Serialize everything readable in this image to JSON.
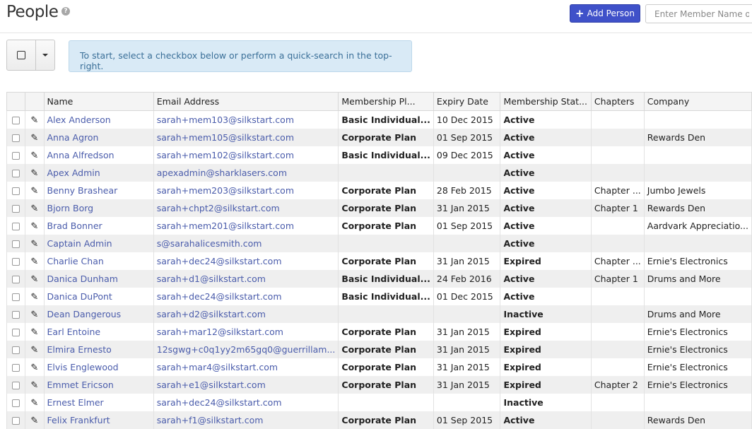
{
  "header": {
    "title": "People",
    "help_icon": "question-circle-icon",
    "add_button": "Add Person",
    "search_placeholder": "Enter Member Name or Email"
  },
  "info_text": "To start, select a checkbox below or perform a quick-search in the top-right.",
  "columns": [
    "Name",
    "Email Address",
    "Membership Pl...",
    "Expiry Date",
    "Membership Stat...",
    "Chapters",
    "Company"
  ],
  "colors": {
    "active": "#4a8a1a",
    "expired": "#c81f1f",
    "inactive": "#a0a0a0",
    "link": "#4a5cab",
    "button": "#3f51c9"
  },
  "rows": [
    {
      "name": "Alex Anderson",
      "email": "sarah+mem103@silkstart.com",
      "plan": "Basic Individual...",
      "plan_color": "green",
      "expiry": "10 Dec 2015",
      "status": "Active",
      "chapters": "",
      "company": ""
    },
    {
      "name": "Anna Agron",
      "email": "sarah+mem105@silkstart.com",
      "plan": "Corporate Plan",
      "plan_color": "green",
      "expiry": "01 Sep 2015",
      "status": "Active",
      "chapters": "",
      "company": "Rewards Den"
    },
    {
      "name": "Anna Alfredson",
      "email": "sarah+mem102@silkstart.com",
      "plan": "Basic Individual...",
      "plan_color": "green",
      "expiry": "09 Dec 2015",
      "status": "Active",
      "chapters": "",
      "company": ""
    },
    {
      "name": "Apex Admin",
      "email": "apexadmin@sharklasers.com",
      "plan": "",
      "plan_color": "green",
      "expiry": "",
      "status": "Active",
      "chapters": "",
      "company": ""
    },
    {
      "name": "Benny Brashear",
      "email": "sarah+mem203@silkstart.com",
      "plan": "Corporate Plan",
      "plan_color": "green",
      "expiry": "28 Feb 2015",
      "status": "Active",
      "chapters": "Chapter ...",
      "company": "Jumbo Jewels"
    },
    {
      "name": "Bjorn Borg",
      "email": "sarah+chpt2@silkstart.com",
      "plan": "Corporate Plan",
      "plan_color": "green",
      "expiry": "31 Jan 2015",
      "status": "Active",
      "chapters": "Chapter 1",
      "company": "Rewards Den"
    },
    {
      "name": "Brad Bonner",
      "email": "sarah+mem201@silkstart.com",
      "plan": "Corporate Plan",
      "plan_color": "green",
      "expiry": "01 Sep 2015",
      "status": "Active",
      "chapters": "",
      "company": "Aardvark Appreciatio..."
    },
    {
      "name": "Captain Admin",
      "email": "s@sarahalicesmith.com",
      "plan": "",
      "plan_color": "green",
      "expiry": "",
      "status": "Active",
      "chapters": "",
      "company": ""
    },
    {
      "name": "Charlie Chan",
      "email": "sarah+dec24@silkstart.com",
      "plan": "Corporate Plan",
      "plan_color": "red",
      "expiry": "31 Jan 2015",
      "status": "Expired",
      "chapters": "Chapter ...",
      "company": "Ernie's Electronics"
    },
    {
      "name": "Danica Dunham",
      "email": "sarah+d1@silkstart.com",
      "plan": "Basic Individual...",
      "plan_color": "green",
      "expiry": "24 Feb 2016",
      "status": "Active",
      "chapters": "Chapter 1",
      "company": "Drums and More"
    },
    {
      "name": "Danica DuPont",
      "email": "sarah+dec24@silkstart.com",
      "plan": "Basic Individual...",
      "plan_color": "green",
      "expiry": "01 Dec 2015",
      "status": "Active",
      "chapters": "",
      "company": ""
    },
    {
      "name": "Dean Dangerous",
      "email": "sarah+d2@silkstart.com",
      "plan": "",
      "plan_color": "green",
      "expiry": "",
      "status": "Inactive",
      "chapters": "",
      "company": "Drums and More"
    },
    {
      "name": "Earl Entoine",
      "email": "sarah+mar12@silkstart.com",
      "plan": "Corporate Plan",
      "plan_color": "red",
      "expiry": "31 Jan 2015",
      "status": "Expired",
      "chapters": "",
      "company": "Ernie's Electronics"
    },
    {
      "name": "Elmira Ernesto",
      "email": "12sgwg+c0q1yy2m65gq0@guerrillam...",
      "plan": "Corporate Plan",
      "plan_color": "red",
      "expiry": "31 Jan 2015",
      "status": "Expired",
      "chapters": "",
      "company": "Ernie's Electronics"
    },
    {
      "name": "Elvis Englewood",
      "email": "sarah+mar4@silkstart.com",
      "plan": "Corporate Plan",
      "plan_color": "red",
      "expiry": "31 Jan 2015",
      "status": "Expired",
      "chapters": "",
      "company": "Ernie's Electronics"
    },
    {
      "name": "Emmet Ericson",
      "email": "sarah+e1@silkstart.com",
      "plan": "Corporate Plan",
      "plan_color": "red",
      "expiry": "31 Jan 2015",
      "status": "Expired",
      "chapters": "Chapter 2",
      "company": "Ernie's Electronics"
    },
    {
      "name": "Ernest Elmer",
      "email": "sarah+dec24@silkstart.com",
      "plan": "",
      "plan_color": "green",
      "expiry": "",
      "status": "Inactive",
      "chapters": "",
      "company": ""
    },
    {
      "name": "Felix Frankfurt",
      "email": "sarah+f1@silkstart.com",
      "plan": "Corporate Plan",
      "plan_color": "green",
      "expiry": "01 Sep 2015",
      "status": "Active",
      "chapters": "",
      "company": "Rewards Den"
    }
  ]
}
